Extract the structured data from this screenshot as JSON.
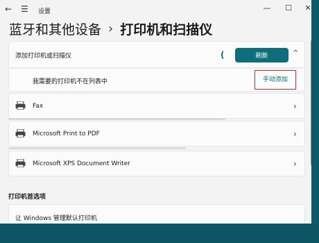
{
  "window": {
    "app_title": "设置",
    "controls": {
      "minimize": "—",
      "maximize": "☐",
      "close": "✕"
    }
  },
  "breadcrumb": {
    "parent": "蓝牙和其他设备",
    "separator": "›",
    "current": "打印机和扫描仪"
  },
  "add_device": {
    "label": "添加打印机或扫描仪",
    "spinner": "(",
    "refresh_label": "刷新",
    "collapse_icon": "^"
  },
  "manual": {
    "label": "我需要的打印机不在列表中",
    "link_label": "手动添加"
  },
  "printers": [
    {
      "name": "Fax",
      "icon": "printer-icon"
    },
    {
      "name": "Microsoft Print to PDF",
      "icon": "printer-icon"
    },
    {
      "name": "Microsoft XPS Document Writer",
      "icon": "printer-icon"
    }
  ],
  "preferences": {
    "section_title": "打印机首选项",
    "item_label": "让 Windows 管理默认打印机"
  },
  "colors": {
    "accent": "#0f6e7c",
    "highlight_border": "#d42a2a",
    "background": "#f3f3f3"
  }
}
